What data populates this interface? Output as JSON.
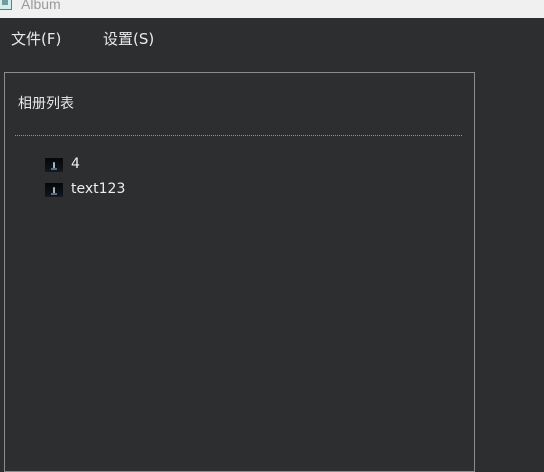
{
  "window": {
    "title": "Album",
    "icon": "album-app-icon"
  },
  "menubar": {
    "file_label": "文件(F)",
    "settings_label": "设置(S)"
  },
  "album_panel": {
    "title": "相册列表",
    "items": [
      {
        "label": "4",
        "icon": "photo-thumbnail-icon"
      },
      {
        "label": "text123",
        "icon": "photo-thumbnail-icon"
      }
    ]
  },
  "colors": {
    "background": "#2d2e30",
    "titlebar": "#f0f0f0",
    "panel_border": "#8b8c8e",
    "text": "#eaeaea"
  }
}
